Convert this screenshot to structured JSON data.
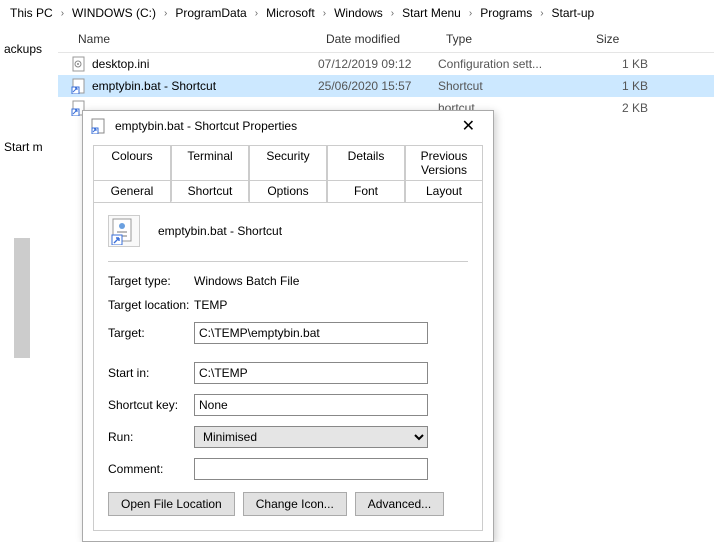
{
  "breadcrumb": [
    "This PC",
    "WINDOWS (C:)",
    "ProgramData",
    "Microsoft",
    "Windows",
    "Start Menu",
    "Programs",
    "Start-up"
  ],
  "columns": {
    "name": "Name",
    "modified": "Date modified",
    "type": "Type",
    "size": "Size"
  },
  "sidebar": {
    "item1": "ackups",
    "item2": "Start m"
  },
  "files": [
    {
      "name": "desktop.ini",
      "modified": "07/12/2019 09:12",
      "type": "Configuration sett...",
      "size": "1 KB",
      "selected": false
    },
    {
      "name": "emptybin.bat - Shortcut",
      "modified": "25/06/2020 15:57",
      "type": "Shortcut",
      "size": "1 KB",
      "selected": true
    },
    {
      "name": "",
      "modified": "",
      "type": "hortcut",
      "size": "2 KB",
      "selected": false
    }
  ],
  "dialog": {
    "title": "emptybin.bat - Shortcut Properties",
    "tabs_top": [
      "Colours",
      "Terminal",
      "Security",
      "Details",
      "Previous Versions"
    ],
    "tabs_bottom": [
      "General",
      "Shortcut",
      "Options",
      "Font",
      "Layout"
    ],
    "active_tab": "Shortcut",
    "icon_label": "emptybin.bat - Shortcut",
    "fields": {
      "target_type_label": "Target type:",
      "target_type": "Windows Batch File",
      "target_location_label": "Target location:",
      "target_location": "TEMP",
      "target_label": "Target:",
      "target": "C:\\TEMP\\emptybin.bat",
      "startin_label": "Start in:",
      "startin": "C:\\TEMP",
      "shortcut_key_label": "Shortcut key:",
      "shortcut_key": "None",
      "run_label": "Run:",
      "run": "Minimised",
      "comment_label": "Comment:",
      "comment": ""
    },
    "buttons": {
      "open": "Open File Location",
      "icon": "Change Icon...",
      "adv": "Advanced..."
    }
  }
}
